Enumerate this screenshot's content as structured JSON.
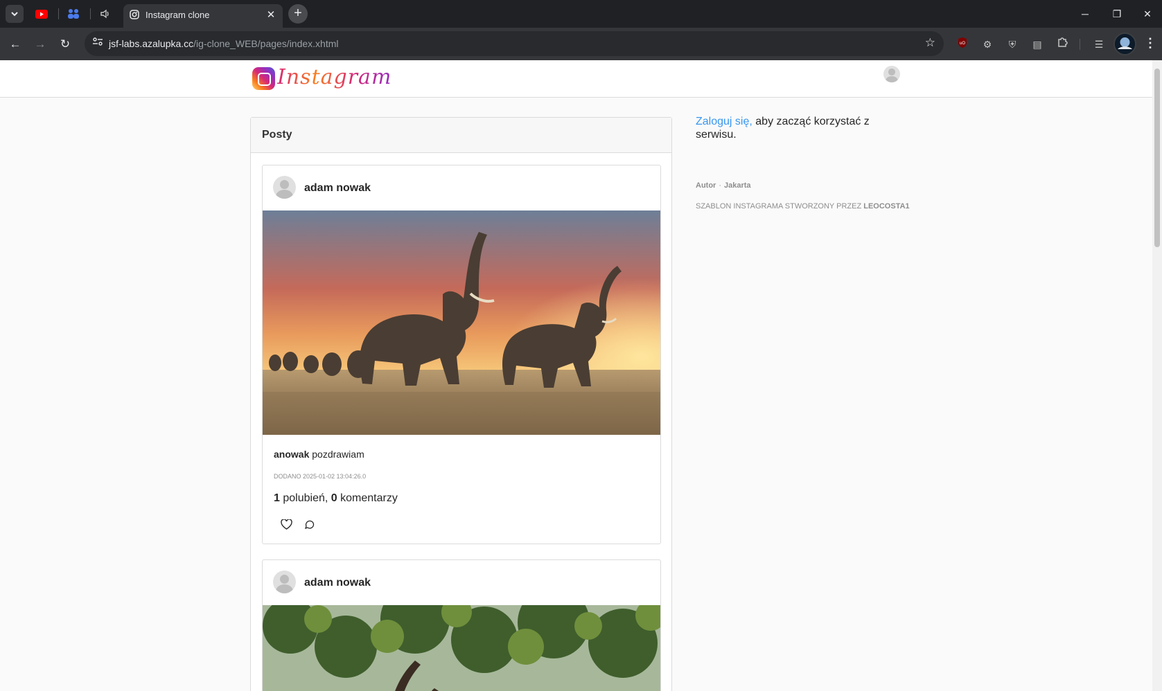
{
  "browser": {
    "tab_title": "Instagram clone",
    "url_host": "jsf-labs.azalupka.cc",
    "url_path": "/ig-clone_WEB/pages/index.xhtml",
    "icons": [
      "chevron-down-icon",
      "youtube-icon",
      "teams-icon",
      "volume-icon",
      "instagram-favicon-icon",
      "close-icon",
      "plus-icon",
      "minimize-icon",
      "restore-icon",
      "close-window-icon",
      "back-icon",
      "forward-icon",
      "reload-icon",
      "site-info-icon",
      "star-icon",
      "ublock-icon",
      "gear-extension-icon",
      "shield-extension-icon",
      "folder-extension-icon",
      "puzzle-icon",
      "reading-list-icon",
      "profile-avatar",
      "kebab-menu-icon"
    ]
  },
  "header": {
    "logo_text": "Instagram",
    "brand_gradient": [
      "#feda75",
      "#fa7e1e",
      "#d62976",
      "#962fbf",
      "#4f5bd5"
    ]
  },
  "posts_card": {
    "title": "Posty"
  },
  "posts": [
    {
      "author": "adam nowak",
      "username": "anowak",
      "caption": "pozdrawiam",
      "date": "DODANO 2025-01-02 13:04:26.0",
      "likes": "1",
      "likes_label": "polubień,",
      "comments": "0",
      "comments_label": "komentarzy",
      "image": "elephants-sunset"
    },
    {
      "author": "adam nowak",
      "image": "green-foliage"
    }
  ],
  "sidebar": {
    "login_link": "Zaloguj się,",
    "login_text": "aby zacząć korzystać z serwisu.",
    "meta_author": "Autor",
    "meta_dot": "·",
    "meta_tech": "Jakarta",
    "credit_prefix": "SZABLON INSTAGRAMA STWORZONY PRZEZ",
    "credit_name": "LEOCOSTA1"
  },
  "colors": {
    "link": "#3897f0",
    "chrome_dark": "#202124",
    "toolbar": "#35363a"
  }
}
